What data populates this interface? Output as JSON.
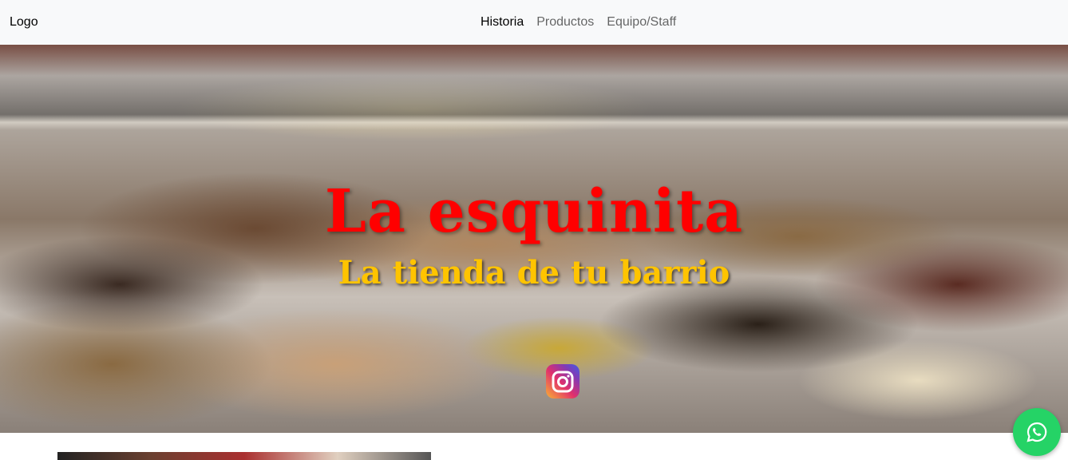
{
  "navbar": {
    "logo": "Logo",
    "links": [
      {
        "label": "Historia",
        "active": true
      },
      {
        "label": "Productos"
      },
      {
        "label": "Equipo/Staff"
      }
    ]
  },
  "hero": {
    "title": "La esquinita",
    "subtitle": "La tienda de tu barrio",
    "title_color": "#ff0000",
    "subtitle_color": "#ffc400"
  },
  "social": {
    "instagram_icon": "instagram-icon",
    "whatsapp_icon": "whatsapp-icon",
    "whatsapp_color": "#25d366"
  }
}
